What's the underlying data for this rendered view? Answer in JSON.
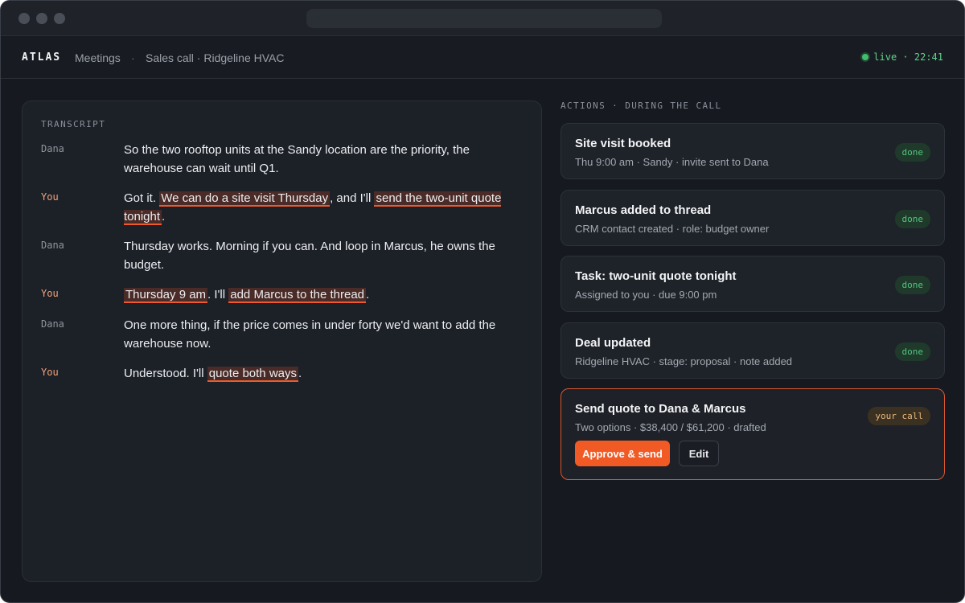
{
  "nav": {
    "brand": "ATLAS",
    "breadcrumb_section": "Meetings",
    "breadcrumb_separator": "·",
    "breadcrumb_current": "Sales call · Ridgeline HVAC",
    "status": "live · 22:41"
  },
  "transcript": {
    "label": "TRANSCRIPT",
    "lines": [
      {
        "speaker": "Dana",
        "segments": [
          "So the two rooftop units at the Sandy location are the priority, the warehouse can wait until Q1."
        ]
      },
      {
        "speaker": "You",
        "segments": [
          "Got it. ",
          "We can do a site visit Thursday",
          ", and I'll ",
          "send the two-unit quote tonight",
          "."
        ]
      },
      {
        "speaker": "Dana",
        "segments": [
          "Thursday works. Morning if you can. And loop in Marcus, he owns the budget."
        ]
      },
      {
        "speaker": "You",
        "segments": [
          "Thursday 9 am",
          ". I'll ",
          "add Marcus to the thread",
          "."
        ]
      },
      {
        "speaker": "Dana",
        "segments": [
          "One more thing, if the price comes in under forty we'd want to add the warehouse now."
        ]
      },
      {
        "speaker": "You",
        "segments": [
          "Understood. I'll ",
          "quote both ways",
          "."
        ]
      }
    ]
  },
  "actions": {
    "label": "ACTIONS · DURING THE CALL",
    "cards": [
      {
        "title": "Site visit booked",
        "subtitle": "Thu 9:00 am · Sandy · invite sent to Dana",
        "badge": "done"
      },
      {
        "title": "Marcus added to thread",
        "subtitle": "CRM contact created · role: budget owner",
        "badge": "done"
      },
      {
        "title": "Task: two-unit quote tonight",
        "subtitle": "Assigned to you · due 9:00 pm",
        "badge": "done"
      },
      {
        "title": "Deal updated",
        "subtitle": "Ridgeline HVAC · stage: proposal · note added",
        "badge": "done"
      }
    ],
    "pending": {
      "title": "Send quote to Dana & Marcus",
      "subtitle": "Two options · $38,400 / $61,200 · drafted",
      "badge": "your call",
      "approve_label": "Approve & send",
      "edit_label": "Edit"
    }
  },
  "colors": {
    "accent": "#f25a25",
    "done_badge": "#53c47e",
    "live_indicator": "#3fbf6c",
    "speaker_you": "#f3a37b"
  }
}
